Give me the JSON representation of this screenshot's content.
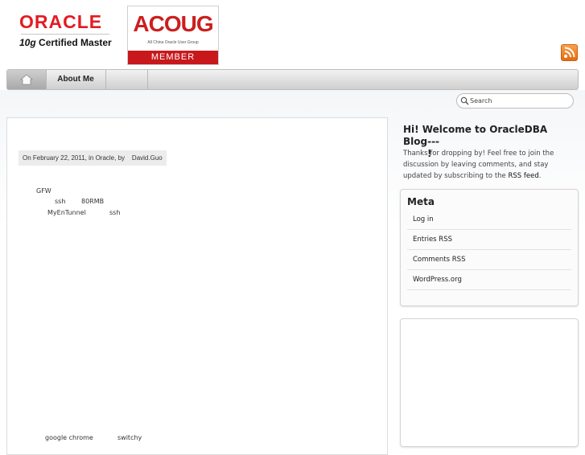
{
  "header": {
    "oracle_logo": {
      "wordmark": "ORACLE",
      "certification": "Certified Master",
      "version_prefix": "10g"
    },
    "acoug_logo": {
      "title": "ACOUG",
      "subtitle": "All China Oracle User Group",
      "badge": "MEMBER"
    },
    "rss_icon": "rss-feed-icon"
  },
  "nav": {
    "home_icon": "home-icon",
    "items": [
      {
        "label": "About Me"
      }
    ]
  },
  "search": {
    "placeholder": "Search"
  },
  "post": {
    "meta": "On February 22, 2011, in Oracle, by    David.Guo",
    "lines": [
      "GFW",
      "ssh",
      "80RMB",
      "MyEnTunnel",
      "ssh",
      "google chrome",
      "switchy"
    ]
  },
  "sidebar": {
    "welcome": {
      "title": "Hi! Welcome to OracleDBA Blog---",
      "title_tail": "!",
      "text": "Thanks for dropping by! Feel free to join the discussion by leaving comments, and stay updated by subscribing to the ",
      "rss_link": "RSS feed",
      "text_end": "."
    },
    "meta": {
      "title": "Meta",
      "links": [
        "Log in",
        "Entries RSS",
        "Comments RSS",
        "WordPress.org"
      ]
    }
  },
  "colors": {
    "oracle_red": "#e31b23",
    "acoug_red": "#c8181c",
    "rss_orange": "#f28a24"
  }
}
